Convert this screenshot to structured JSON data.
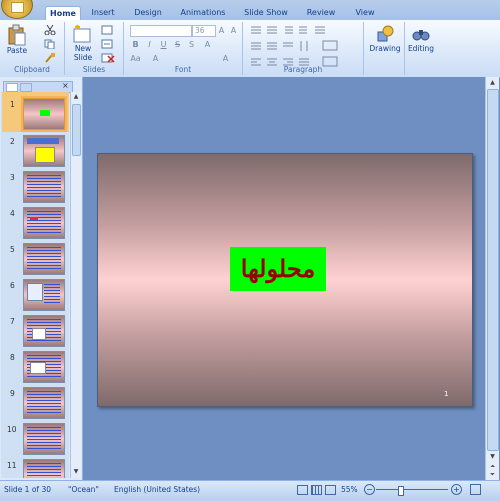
{
  "ribbon": {
    "tabs": [
      "Home",
      "Insert",
      "Design",
      "Animations",
      "Slide Show",
      "Review",
      "View"
    ],
    "active_tab": "Home",
    "clipboard": {
      "paste_label": "Paste",
      "group_label": "Clipboard"
    },
    "slides": {
      "new_slide_label": "New Slide",
      "group_label": "Slides"
    },
    "font": {
      "size_value": "36",
      "group_label": "Font"
    },
    "paragraph": {
      "group_label": "Paragraph"
    },
    "drawing": {
      "label": "Drawing"
    },
    "editing": {
      "label": "Editing"
    }
  },
  "slide_panel": {
    "slide_numbers": [
      "1",
      "2",
      "3",
      "4",
      "5",
      "6",
      "7",
      "8",
      "9",
      "10",
      "11"
    ]
  },
  "slide": {
    "title": "محلولها",
    "number": "1"
  },
  "status": {
    "slide_of": "Slide 1 of 30",
    "theme": "\"Ocean\"",
    "language": "English (United States)",
    "zoom": "55%"
  },
  "colors": {
    "title_box": "#00ff00",
    "title_text": "#990000",
    "accent_tab": "#15428b"
  }
}
